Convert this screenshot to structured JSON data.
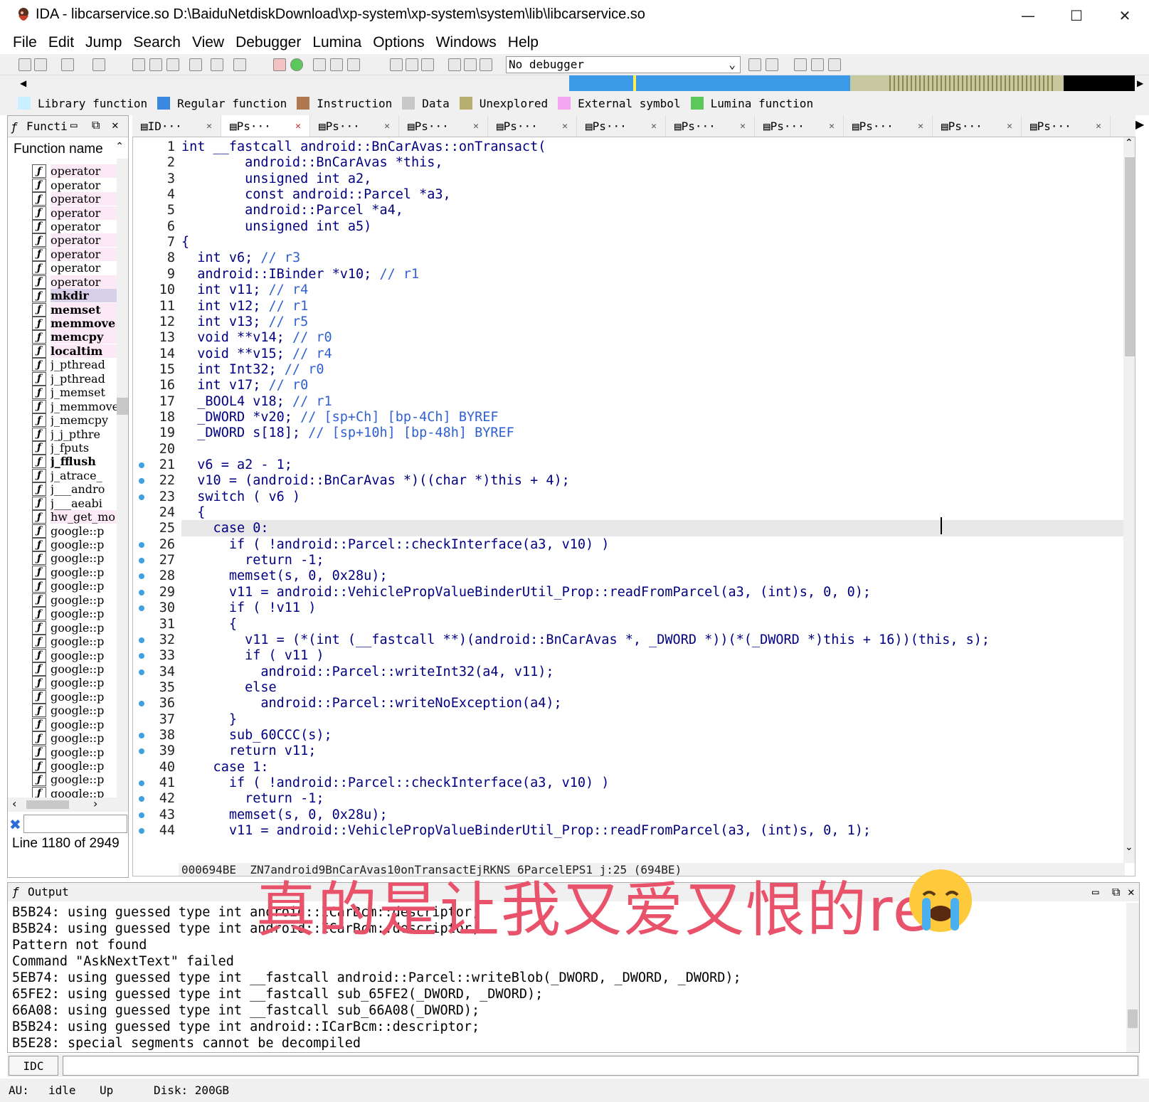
{
  "window": {
    "title": "IDA - libcarservice.so D:\\BaiduNetdiskDownload\\xp-system\\xp-system\\system\\lib\\libcarservice.so",
    "minimize": "—",
    "maximize": "☐",
    "close": "✕"
  },
  "menu": [
    "File",
    "Edit",
    "Jump",
    "Search",
    "View",
    "Debugger",
    "Lumina",
    "Options",
    "Windows",
    "Help"
  ],
  "toolbar": {
    "debugger": "No debugger"
  },
  "legend": [
    {
      "label": "Library function",
      "color": "#c8f0ff"
    },
    {
      "label": "Regular function",
      "color": "#3a88e0"
    },
    {
      "label": "Instruction",
      "color": "#b07850"
    },
    {
      "label": "Data",
      "color": "#c8c8c8"
    },
    {
      "label": "Unexplored",
      "color": "#b8b070"
    },
    {
      "label": "External symbol",
      "color": "#f4a6f0"
    },
    {
      "label": "Lumina function",
      "color": "#5ac85a"
    }
  ],
  "functions_panel": {
    "title": "Functi",
    "column": "Function name",
    "status": "Line 1180 of 2949",
    "items": [
      {
        "name": "operator",
        "style": "pink"
      },
      {
        "name": "operator",
        "style": "normal"
      },
      {
        "name": "operator",
        "style": "pink"
      },
      {
        "name": "operator",
        "style": "pink"
      },
      {
        "name": "operator",
        "style": "normal"
      },
      {
        "name": "operator",
        "style": "pink"
      },
      {
        "name": "operator",
        "style": "pink"
      },
      {
        "name": "operator",
        "style": "normal"
      },
      {
        "name": "operator",
        "style": "pink"
      },
      {
        "name": "mkdir",
        "style": "sel"
      },
      {
        "name": "memset",
        "style": "pinkbold"
      },
      {
        "name": "memmove",
        "style": "pinkbold"
      },
      {
        "name": "memcpy",
        "style": "pinkbold"
      },
      {
        "name": "localtim",
        "style": "pinkbold"
      },
      {
        "name": "j_pthread",
        "style": "normal"
      },
      {
        "name": "j_pthread",
        "style": "normal"
      },
      {
        "name": "j_memset",
        "style": "normal"
      },
      {
        "name": "j_memmove",
        "style": "normal"
      },
      {
        "name": "j_memcpy",
        "style": "normal"
      },
      {
        "name": "j_j_pthre",
        "style": "normal"
      },
      {
        "name": "j_fputs",
        "style": "normal"
      },
      {
        "name": "j_fflush",
        "style": "bold"
      },
      {
        "name": "j_atrace_",
        "style": "normal"
      },
      {
        "name": "j___andro",
        "style": "normal"
      },
      {
        "name": "j___aeabi",
        "style": "normal"
      },
      {
        "name": "hw_get_mo",
        "style": "pink"
      },
      {
        "name": "google::p",
        "style": "normal"
      },
      {
        "name": "google::p",
        "style": "normal"
      },
      {
        "name": "google::p",
        "style": "normal"
      },
      {
        "name": "google::p",
        "style": "normal"
      },
      {
        "name": "google::p",
        "style": "normal"
      },
      {
        "name": "google::p",
        "style": "normal"
      },
      {
        "name": "google::p",
        "style": "normal"
      },
      {
        "name": "google::p",
        "style": "normal"
      },
      {
        "name": "google::p",
        "style": "normal"
      },
      {
        "name": "google::p",
        "style": "normal"
      },
      {
        "name": "google::p",
        "style": "normal"
      },
      {
        "name": "google::p",
        "style": "normal"
      },
      {
        "name": "google::p",
        "style": "normal"
      },
      {
        "name": "google::p",
        "style": "normal"
      },
      {
        "name": "google::p",
        "style": "normal"
      },
      {
        "name": "google::p",
        "style": "normal"
      },
      {
        "name": "google::p",
        "style": "normal"
      },
      {
        "name": "google::p",
        "style": "normal"
      },
      {
        "name": "google::p",
        "style": "normal"
      },
      {
        "name": "google::p",
        "style": "normal"
      }
    ]
  },
  "tabs": [
    {
      "label": "ID···",
      "active": false
    },
    {
      "label": "Ps···",
      "active": true
    },
    {
      "label": "Ps···",
      "active": false
    },
    {
      "label": "Ps···",
      "active": false
    },
    {
      "label": "Ps···",
      "active": false
    },
    {
      "label": "Ps···",
      "active": false
    },
    {
      "label": "Ps···",
      "active": false
    },
    {
      "label": "Ps···",
      "active": false
    },
    {
      "label": "Ps···",
      "active": false
    },
    {
      "label": "Ps···",
      "active": false
    },
    {
      "label": "Ps···",
      "active": false
    }
  ],
  "code": [
    {
      "n": "1",
      "t": "int __fastcall android::BnCarAvas::onTransact(",
      "dot": false
    },
    {
      "n": "2",
      "t": "        android::BnCarAvas *this,",
      "dot": false
    },
    {
      "n": "3",
      "t": "        unsigned int a2,",
      "dot": false
    },
    {
      "n": "4",
      "t": "        const android::Parcel *a3,",
      "dot": false
    },
    {
      "n": "5",
      "t": "        android::Parcel *a4,",
      "dot": false
    },
    {
      "n": "6",
      "t": "        unsigned int a5)",
      "dot": false
    },
    {
      "n": "7",
      "t": "{",
      "dot": false
    },
    {
      "n": "8",
      "t": "  int v6; // r3",
      "dot": false
    },
    {
      "n": "9",
      "t": "  android::IBinder *v10; // r1",
      "dot": false
    },
    {
      "n": "10",
      "t": "  int v11; // r4",
      "dot": false
    },
    {
      "n": "11",
      "t": "  int v12; // r1",
      "dot": false
    },
    {
      "n": "12",
      "t": "  int v13; // r5",
      "dot": false
    },
    {
      "n": "13",
      "t": "  void **v14; // r0",
      "dot": false
    },
    {
      "n": "14",
      "t": "  void **v15; // r4",
      "dot": false
    },
    {
      "n": "15",
      "t": "  int Int32; // r0",
      "dot": false
    },
    {
      "n": "16",
      "t": "  int v17; // r0",
      "dot": false
    },
    {
      "n": "17",
      "t": "  _BOOL4 v18; // r1",
      "dot": false
    },
    {
      "n": "18",
      "t": "  _DWORD *v20; // [sp+Ch] [bp-4Ch] BYREF",
      "dot": false
    },
    {
      "n": "19",
      "t": "  _DWORD s[18]; // [sp+10h] [bp-48h] BYREF",
      "dot": false
    },
    {
      "n": "20",
      "t": "",
      "dot": false
    },
    {
      "n": "21",
      "t": "  v6 = a2 - 1;",
      "dot": true
    },
    {
      "n": "22",
      "t": "  v10 = (android::BnCarAvas *)((char *)this + 4);",
      "dot": true
    },
    {
      "n": "23",
      "t": "  switch ( v6 )",
      "dot": true
    },
    {
      "n": "24",
      "t": "  {",
      "dot": false
    },
    {
      "n": "25",
      "t": "    case 0:",
      "dot": false
    },
    {
      "n": "26",
      "t": "      if ( !android::Parcel::checkInterface(a3, v10) )",
      "dot": true
    },
    {
      "n": "27",
      "t": "        return -1;",
      "dot": true
    },
    {
      "n": "28",
      "t": "      memset(s, 0, 0x28u);",
      "dot": true
    },
    {
      "n": "29",
      "t": "      v11 = android::VehiclePropValueBinderUtil_Prop::readFromParcel(a3, (int)s, 0, 0);",
      "dot": true
    },
    {
      "n": "30",
      "t": "      if ( !v11 )",
      "dot": true
    },
    {
      "n": "31",
      "t": "      {",
      "dot": false
    },
    {
      "n": "32",
      "t": "        v11 = (*(int (__fastcall **)(android::BnCarAvas *, _DWORD *))(*(_DWORD *)this + 16))(this, s);",
      "dot": true
    },
    {
      "n": "33",
      "t": "        if ( v11 )",
      "dot": true
    },
    {
      "n": "34",
      "t": "          android::Parcel::writeInt32(a4, v11);",
      "dot": true
    },
    {
      "n": "35",
      "t": "        else",
      "dot": false
    },
    {
      "n": "36",
      "t": "          android::Parcel::writeNoException(a4);",
      "dot": true
    },
    {
      "n": "37",
      "t": "      }",
      "dot": false
    },
    {
      "n": "38",
      "t": "      sub_60CCC(s);",
      "dot": true
    },
    {
      "n": "39",
      "t": "      return v11;",
      "dot": true
    },
    {
      "n": "40",
      "t": "    case 1:",
      "dot": false
    },
    {
      "n": "41",
      "t": "      if ( !android::Parcel::checkInterface(a3, v10) )",
      "dot": true
    },
    {
      "n": "42",
      "t": "        return -1;",
      "dot": true
    },
    {
      "n": "43",
      "t": "      memset(s, 0, 0x28u);",
      "dot": true
    },
    {
      "n": "44",
      "t": "      v11 = android::VehiclePropValueBinderUtil_Prop::readFromParcel(a3, (int)s, 0, 1);",
      "dot": true
    }
  ],
  "code_status": "000694BE _ZN7android9BnCarAvas10onTransactEjRKNS_6ParcelEPS1_j:25 (694BE)",
  "output": {
    "title": "Output",
    "lines": [
      "B5B24: using guessed type int android::ICarBcm::descriptor;",
      "B5B24: using guessed type int android::ICarBcm::descriptor;",
      "Pattern not found",
      "Command \"AskNextText\" failed",
      "5EB74: using guessed type int __fastcall android::Parcel::writeBlob(_DWORD, _DWORD, _DWORD);",
      "65FE2: using guessed type int __fastcall sub_65FE2(_DWORD, _DWORD);",
      "66A08: using guessed type int __fastcall sub_66A08(_DWORD);",
      "B5B24: using guessed type int android::ICarBcm::descriptor;",
      "B5E28: special segments cannot be decompiled"
    ]
  },
  "idc_button": "IDC",
  "status": {
    "au_label": "AU:",
    "au_value": "idle",
    "direction": "Up",
    "disk": "Disk: 200GB"
  },
  "overlay_caption": "真的是让我又爱又恨的re"
}
